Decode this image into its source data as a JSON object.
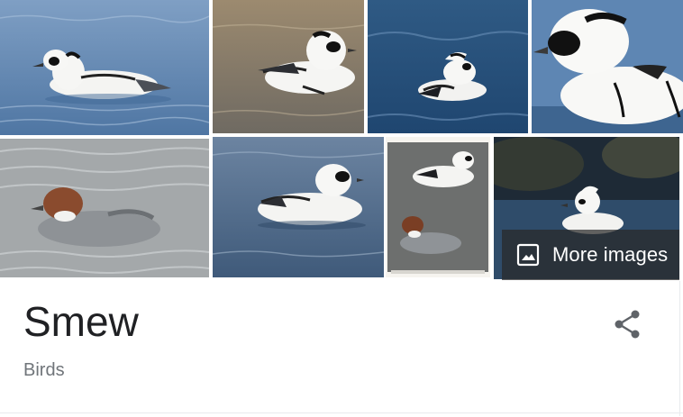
{
  "knowledge_panel": {
    "title": "Smew",
    "subtitle": "Birds",
    "more_images_label": "More images",
    "share_icon": "share-icon",
    "more_images_icon": "image-icon"
  },
  "colors": {
    "title": "#202124",
    "subtitle": "#70757a",
    "overlay": "#282828"
  }
}
